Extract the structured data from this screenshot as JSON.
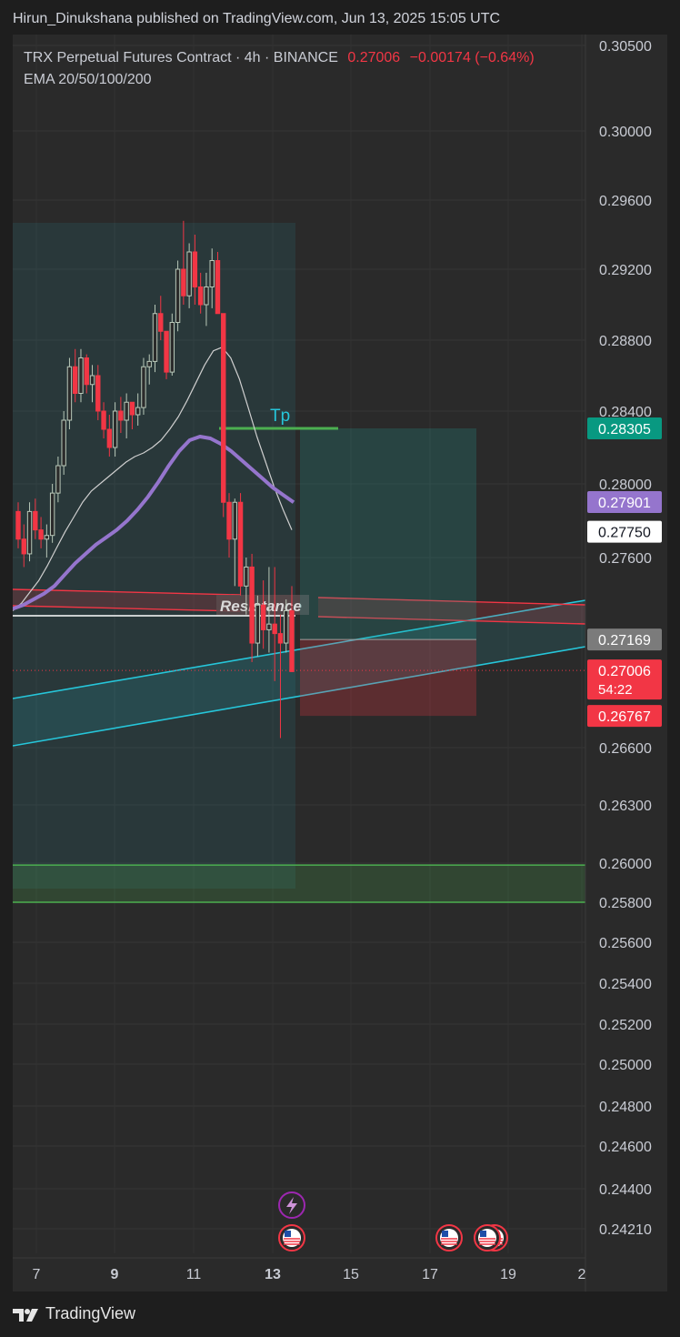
{
  "header": {
    "publisher_line": "Hirun_Dinukshana published on TradingView.com, Jun 13, 2025 15:05 UTC"
  },
  "legend": {
    "symbol": "TRX Perpetual Futures Contract · 4h · BINANCE",
    "last_price": "0.27006",
    "change": "−0.00174 (−0.64%)",
    "indicator": "EMA 20/50/100/200"
  },
  "footer": {
    "brand": "TradingView"
  },
  "colors": {
    "up": "#26a69a",
    "down": "#f23645",
    "ema_purple": "#9575cd",
    "ema_white": "#cfcfcf",
    "channel": "#26c6da",
    "resistance": "#f23645",
    "tp_line": "#4caf50",
    "support_zone": "#4caf50"
  },
  "chart_data": {
    "type": "candlestick",
    "symbol": "TRX Perpetual Futures Contract",
    "interval": "4h",
    "exchange": "BINANCE",
    "y_ticks": [
      "0.30500",
      "0.30000",
      "0.29600",
      "0.29200",
      "0.28800",
      "0.28400",
      "0.28000",
      "0.27600",
      "0.26600",
      "0.26300",
      "0.26000",
      "0.25800",
      "0.25600",
      "0.25400",
      "0.25200",
      "0.25000",
      "0.24800",
      "0.24600",
      "0.24400",
      "0.24210"
    ],
    "x_ticks": [
      "7",
      "9",
      "11",
      "13",
      "15",
      "17",
      "19",
      "2"
    ],
    "price_labels": [
      {
        "value": "0.28305",
        "kind": "take-profit"
      },
      {
        "value": "0.27901",
        "kind": "ema"
      },
      {
        "value": "0.27750",
        "kind": "ema"
      },
      {
        "value": "0.27169",
        "kind": "entry"
      },
      {
        "value": "0.27006",
        "kind": "last",
        "countdown": "54:22"
      },
      {
        "value": "0.26767",
        "kind": "stop-loss"
      }
    ],
    "annotations": [
      {
        "text": "Tp",
        "price": 0.28305
      },
      {
        "text": "Resistance"
      }
    ],
    "candles": [
      [
        0.2785,
        0.279,
        0.2765,
        0.277
      ],
      [
        0.277,
        0.2778,
        0.2755,
        0.2762
      ],
      [
        0.2762,
        0.279,
        0.2758,
        0.2785
      ],
      [
        0.2785,
        0.2792,
        0.277,
        0.2775
      ],
      [
        0.2775,
        0.2782,
        0.2765,
        0.277
      ],
      [
        0.277,
        0.2778,
        0.276,
        0.2772
      ],
      [
        0.2772,
        0.28,
        0.2768,
        0.2795
      ],
      [
        0.2795,
        0.2815,
        0.279,
        0.281
      ],
      [
        0.281,
        0.284,
        0.2805,
        0.2835
      ],
      [
        0.2835,
        0.287,
        0.283,
        0.2865
      ],
      [
        0.2865,
        0.2875,
        0.2845,
        0.285
      ],
      [
        0.285,
        0.2875,
        0.2845,
        0.287
      ],
      [
        0.287,
        0.2872,
        0.285,
        0.2855
      ],
      [
        0.2855,
        0.2866,
        0.2845,
        0.286
      ],
      [
        0.286,
        0.2866,
        0.2835,
        0.284
      ],
      [
        0.284,
        0.2845,
        0.2825,
        0.283
      ],
      [
        0.283,
        0.2838,
        0.2815,
        0.282
      ],
      [
        0.282,
        0.2845,
        0.2815,
        0.284
      ],
      [
        0.284,
        0.2848,
        0.2828,
        0.2835
      ],
      [
        0.2835,
        0.285,
        0.2825,
        0.2845
      ],
      [
        0.2845,
        0.2842,
        0.283,
        0.2838
      ],
      [
        0.2838,
        0.285,
        0.2832,
        0.2842
      ],
      [
        0.2842,
        0.287,
        0.2838,
        0.2865
      ],
      [
        0.2865,
        0.2872,
        0.2855,
        0.2868
      ],
      [
        0.2868,
        0.29,
        0.2862,
        0.2895
      ],
      [
        0.2895,
        0.2905,
        0.288,
        0.2885
      ],
      [
        0.2885,
        0.2868,
        0.2858,
        0.2862
      ],
      [
        0.2862,
        0.2895,
        0.286,
        0.289
      ],
      [
        0.289,
        0.2925,
        0.2885,
        0.292
      ],
      [
        0.292,
        0.2948,
        0.29,
        0.2905
      ],
      [
        0.2905,
        0.2935,
        0.2898,
        0.293
      ],
      [
        0.293,
        0.294,
        0.29,
        0.291
      ],
      [
        0.291,
        0.2918,
        0.2895,
        0.29
      ],
      [
        0.29,
        0.2918,
        0.2888,
        0.291
      ],
      [
        0.291,
        0.2932,
        0.2898,
        0.2925
      ],
      [
        0.2925,
        0.293,
        0.2895,
        0.2895
      ],
      [
        0.2895,
        0.2895,
        0.2782,
        0.279
      ],
      [
        0.279,
        0.2795,
        0.276,
        0.277
      ],
      [
        0.277,
        0.2792,
        0.2745,
        0.279
      ],
      [
        0.279,
        0.2795,
        0.274,
        0.2745
      ],
      [
        0.2745,
        0.276,
        0.273,
        0.2755
      ],
      [
        0.2755,
        0.2762,
        0.2705,
        0.2715
      ],
      [
        0.2715,
        0.274,
        0.2708,
        0.2735
      ],
      [
        0.2735,
        0.2748,
        0.2712,
        0.2722
      ],
      [
        0.2722,
        0.2755,
        0.271,
        0.2725
      ],
      [
        0.2725,
        0.2755,
        0.2695,
        0.272
      ],
      [
        0.272,
        0.273,
        0.2665,
        0.2715
      ],
      [
        0.2715,
        0.2738,
        0.271,
        0.2732
      ],
      [
        0.2732,
        0.2745,
        0.2702,
        0.27
      ]
    ],
    "ema_fast": [
      0.2732,
      0.2736,
      0.2742,
      0.2748,
      0.2756,
      0.2765,
      0.2774,
      0.2782,
      0.279,
      0.2796,
      0.28,
      0.2804,
      0.2808,
      0.2812,
      0.2815,
      0.2817,
      0.282,
      0.2824,
      0.283,
      0.2837,
      0.2846,
      0.2856,
      0.2866,
      0.2874,
      0.2876,
      0.287,
      0.2858,
      0.2842,
      0.2826,
      0.2812,
      0.2798,
      0.2786,
      0.2775
    ],
    "ema_slow": [
      0.2733,
      0.2735,
      0.2738,
      0.2741,
      0.2745,
      0.2751,
      0.2757,
      0.2762,
      0.2767,
      0.2771,
      0.2775,
      0.278,
      0.2786,
      0.2793,
      0.2801,
      0.281,
      0.2818,
      0.2824,
      0.2826,
      0.2825,
      0.2822,
      0.2818,
      0.2813,
      0.2808,
      0.2803,
      0.2798,
      0.2794,
      0.279
    ],
    "position": {
      "entry": 0.27169,
      "take_profit": 0.28305,
      "stop_loss": 0.26767
    },
    "support_zone": [
      0.258,
      0.2599
    ],
    "resistance_price": 0.2737
  }
}
